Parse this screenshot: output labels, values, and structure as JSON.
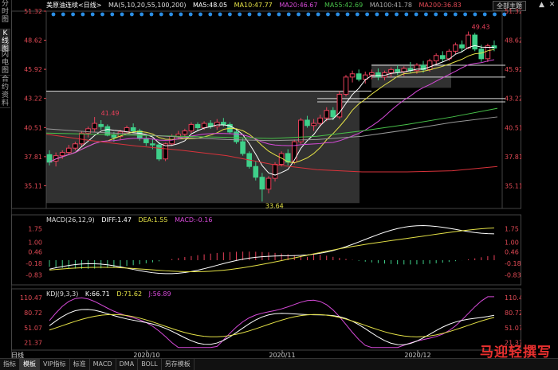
{
  "sidebar": {
    "tabs": [
      {
        "label": "分时图",
        "active": false
      },
      {
        "label": "K线图",
        "active": true
      },
      {
        "label": "闪电图",
        "active": false
      },
      {
        "label": "合约资料",
        "active": false
      }
    ]
  },
  "header": {
    "symbol": "美原油连续<日线>",
    "ma_params": "MA(5,10,20,55,100,200)",
    "ma5": "MA5:48.05",
    "ma10": "MA10:47.77",
    "ma20": "MA20:46.67",
    "ma55": "MA55:42.69",
    "ma100": "MA100:41.78",
    "ma200": "MA200:36.83",
    "theme_button": "全部主题",
    "up_icon": "▲",
    "close_icon": "✕"
  },
  "colors": {
    "up": "#e8405a",
    "down": "#3fd08a",
    "ma5": "#ffffff",
    "ma10": "#e5e247",
    "ma20": "#d64ad8",
    "ma55": "#48c24a",
    "ma100": "#999999",
    "ma200": "#d9333b",
    "axis": "#e24a55"
  },
  "price_axis": {
    "ticks": [
      "51.32",
      "48.62",
      "45.92",
      "43.22",
      "40.51",
      "37.81",
      "35.11"
    ]
  },
  "macd": {
    "title": "MACD(26,12,9)",
    "diff": "DIFF:1.47",
    "dea": "DEA:1.55",
    "macd": "MACD:-0.16",
    "ticks": [
      "1.75",
      "1.00",
      "0.46",
      "-0.18",
      "-0.83"
    ]
  },
  "kdj": {
    "title": "KDJ(9,3,3)",
    "k": "K:66.71",
    "d": "D:71.62",
    "j": "J:56.89",
    "ticks": [
      "110.47",
      "80.72",
      "51.07",
      "21.37"
    ]
  },
  "x_axis": {
    "labels": [
      "2020/10",
      "2020/11",
      "2020/12"
    ]
  },
  "bottom_bar": {
    "period": "日线",
    "tabs": [
      "指标",
      "模板",
      "VIP指标",
      "标准",
      "MACD",
      "DMA",
      "BOLL",
      "另存模板"
    ],
    "active_tab": 1,
    "watermark": "马迎轻撰写"
  },
  "chart_data": {
    "type": "candlestick",
    "price_range": [
      33.0,
      51.32
    ],
    "annotations": {
      "high_label": "49.43",
      "low_label": "33.64",
      "left_high_label": "41.49"
    },
    "candles": [
      [
        38.0,
        38.4,
        37.0,
        37.3
      ],
      [
        37.4,
        38.2,
        36.9,
        37.9
      ],
      [
        37.9,
        38.4,
        37.6,
        38.2
      ],
      [
        38.2,
        38.9,
        38.0,
        38.6
      ],
      [
        38.6,
        39.2,
        38.4,
        39.0
      ],
      [
        39.0,
        40.2,
        38.8,
        40.0
      ],
      [
        40.0,
        40.6,
        39.6,
        40.4
      ],
      [
        40.4,
        41.49,
        40.1,
        40.9
      ],
      [
        40.8,
        41.2,
        40.3,
        40.6
      ],
      [
        40.6,
        40.8,
        39.7,
        39.8
      ],
      [
        39.8,
        40.1,
        39.2,
        39.6
      ],
      [
        39.7,
        40.3,
        39.4,
        40.1
      ],
      [
        40.1,
        40.7,
        39.9,
        40.5
      ],
      [
        40.5,
        40.9,
        40.0,
        40.2
      ],
      [
        40.2,
        40.4,
        39.3,
        39.5
      ],
      [
        39.5,
        39.9,
        38.8,
        39.1
      ],
      [
        39.0,
        39.5,
        38.5,
        38.9
      ],
      [
        38.9,
        39.2,
        37.4,
        37.6
      ],
      [
        37.6,
        39.1,
        37.4,
        39.0
      ],
      [
        39.0,
        39.9,
        38.8,
        39.7
      ],
      [
        39.7,
        40.2,
        39.4,
        39.9
      ],
      [
        39.9,
        40.4,
        39.6,
        40.2
      ],
      [
        40.2,
        41.0,
        40.0,
        40.8
      ],
      [
        40.8,
        41.0,
        40.2,
        40.5
      ],
      [
        40.5,
        41.1,
        40.3,
        40.9
      ],
      [
        40.9,
        41.2,
        40.4,
        40.6
      ],
      [
        40.6,
        41.3,
        40.3,
        41.0
      ],
      [
        41.0,
        41.4,
        40.6,
        40.8
      ],
      [
        40.8,
        41.0,
        39.9,
        40.1
      ],
      [
        40.1,
        40.4,
        39.0,
        39.2
      ],
      [
        39.2,
        39.5,
        37.9,
        38.1
      ],
      [
        38.1,
        38.3,
        36.7,
        36.9
      ],
      [
        36.9,
        37.4,
        35.6,
        35.9
      ],
      [
        35.9,
        36.3,
        33.64,
        34.8
      ],
      [
        34.8,
        36.0,
        34.4,
        35.8
      ],
      [
        35.8,
        37.3,
        35.5,
        37.1
      ],
      [
        37.1,
        38.3,
        36.9,
        38.1
      ],
      [
        38.1,
        38.5,
        37.0,
        37.3
      ],
      [
        37.3,
        39.4,
        37.1,
        39.2
      ],
      [
        39.2,
        41.4,
        39.0,
        41.2
      ],
      [
        41.2,
        41.6,
        40.5,
        40.7
      ],
      [
        40.7,
        41.3,
        40.2,
        40.9
      ],
      [
        40.9,
        41.7,
        40.6,
        41.4
      ],
      [
        41.4,
        42.4,
        41.1,
        42.1
      ],
      [
        42.1,
        42.4,
        41.2,
        41.5
      ],
      [
        41.5,
        43.9,
        41.3,
        43.6
      ],
      [
        43.6,
        45.4,
        43.4,
        45.2
      ],
      [
        45.2,
        45.8,
        44.7,
        45.5
      ],
      [
        45.5,
        45.9,
        44.8,
        45.0
      ],
      [
        45.0,
        45.7,
        44.6,
        45.4
      ],
      [
        45.4,
        45.9,
        45.0,
        45.6
      ],
      [
        45.6,
        46.0,
        44.9,
        45.2
      ],
      [
        45.2,
        45.8,
        44.9,
        45.6
      ],
      [
        45.6,
        46.1,
        45.2,
        45.9
      ],
      [
        45.9,
        46.3,
        45.4,
        45.7
      ],
      [
        45.7,
        46.2,
        45.3,
        46.0
      ],
      [
        46.0,
        46.6,
        45.6,
        45.8
      ],
      [
        45.8,
        46.5,
        45.5,
        46.3
      ],
      [
        46.3,
        46.7,
        45.6,
        45.9
      ],
      [
        45.9,
        46.9,
        45.7,
        46.7
      ],
      [
        46.7,
        47.4,
        46.4,
        47.2
      ],
      [
        47.2,
        47.6,
        46.6,
        46.9
      ],
      [
        46.9,
        47.8,
        46.7,
        47.6
      ],
      [
        47.6,
        48.4,
        47.3,
        48.2
      ],
      [
        48.2,
        48.6,
        47.5,
        47.9
      ],
      [
        47.9,
        49.43,
        47.8,
        49.1
      ],
      [
        49.1,
        49.3,
        47.6,
        47.8
      ],
      [
        47.8,
        48.2,
        46.6,
        46.9
      ],
      [
        46.9,
        48.3,
        46.6,
        48.1
      ],
      [
        48.1,
        48.6,
        47.6,
        47.9
      ]
    ]
  }
}
